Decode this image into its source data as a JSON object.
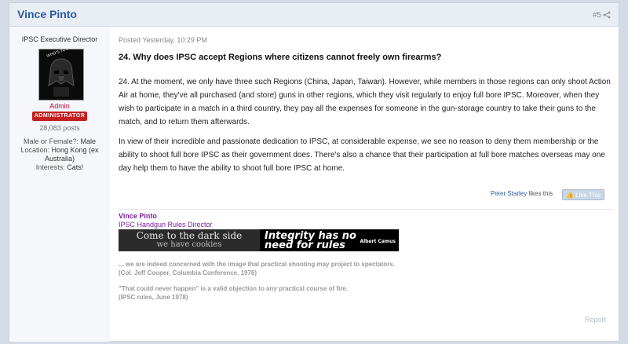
{
  "post": {
    "author": "Vince Pinto",
    "number": "#5",
    "share_icon": "share-icon"
  },
  "sidebar": {
    "user_title": "IPSC Executive Director",
    "avatar_text": "WHO'S YOUR DADDY?",
    "role": "Admin",
    "badge": "ADMINISTRATOR",
    "post_count": "28,083 posts",
    "fields": [
      {
        "label": "Male or Female?:",
        "value": "Male"
      },
      {
        "label": "Location:",
        "value": "Hong Kong (ex Australia)"
      },
      {
        "label": "Interests:",
        "value": "Cats!"
      }
    ]
  },
  "content": {
    "timestamp": "Posted Yesterday, 10:29 PM",
    "question": "24. Why does IPSC accept Regions where citizens cannot freely own firearms?",
    "paragraph1": "24. At the moment, we only have three such Regions (China, Japan, Taiwan). However, while members in those regions can only shoot Action Air at home, they've all purchased (and store) guns in other regions, which they visit regularly to enjoy full bore IPSC. Moreover, when they wish to participate in a match in a third country, they pay all the expenses for someone in the gun-storage country to take their guns to the match, and to return them afterwards.",
    "paragraph2": "In view of their incredible and passionate dedication to IPSC, at considerable expense, we see no reason to deny them membership or the ability to shoot full bore IPSC as their government does. There's also a chance that their participation at full bore matches overseas may one day help them to have the ability to shoot full bore IPSC at home.",
    "likes_who": "Peter Starley",
    "likes_suffix": " likes this",
    "like_button": "Like This"
  },
  "signature": {
    "name": "Vince Pinto",
    "title": "IPSC Handgun Rules Director",
    "banner_left_1": "Come to the dark side",
    "banner_left_2": "we have cookies",
    "banner_right_1": "Integrity has no",
    "banner_right_2": "need for rules",
    "banner_right_by": "Albert Camus",
    "quote1_line1": "... we are indeed concerned with the image that practical shooting may project to spectators.",
    "quote1_line2": "(Col. Jeff Cooper, Columbia Conference, 1976)",
    "quote2_line1": "\"That could never happen\" is a valid objection to any practical course of fire.",
    "quote2_line2": "(IPSC rules, June 1978)"
  },
  "footer": {
    "report": "Report"
  },
  "colors": {
    "author": "#2a5aa6",
    "signature": "#7a1f9e",
    "badge": "#c41e1e"
  }
}
